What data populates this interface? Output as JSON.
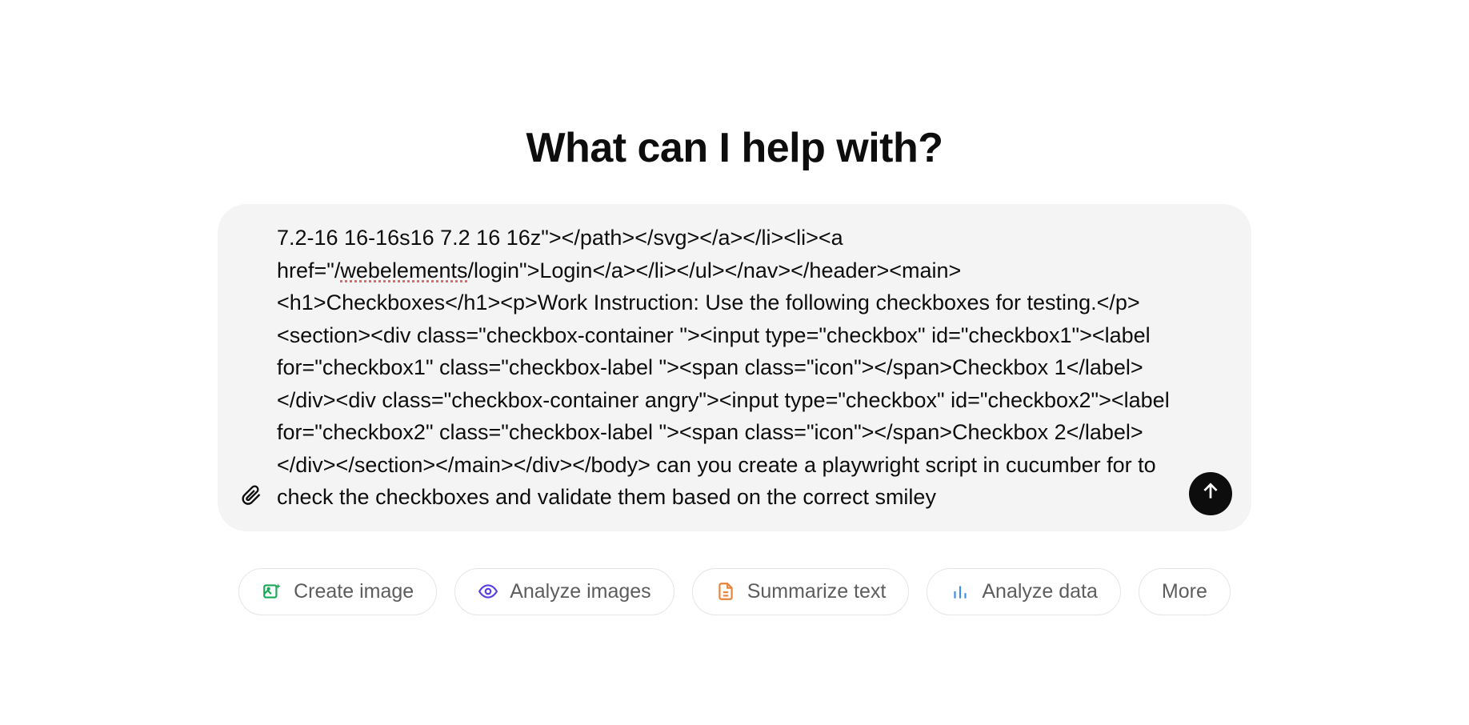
{
  "heading": "What can I help with?",
  "message": {
    "pre_underline": "7.2-16 16-16s16 7.2 16 16z\"></path></svg></a></li><li><a href=\"/",
    "underlined": "webelements",
    "post_underline": "/login\">Login</a></li></ul></nav></header><main><h1>Checkboxes</h1><p>Work Instruction: Use the following checkboxes for testing.</p><section><div class=\"checkbox-container \"><input type=\"checkbox\" id=\"checkbox1\"><label for=\"checkbox1\" class=\"checkbox-label \"><span class=\"icon\"></span>Checkbox 1</label></div><div class=\"checkbox-container angry\"><input type=\"checkbox\" id=\"checkbox2\"><label for=\"checkbox2\" class=\"checkbox-label \"><span class=\"icon\"></span>Checkbox 2</label></div></section></main></div></body> can you create a playwright script in cucumber for to check the checkboxes and validate them based on the correct smiley"
  },
  "suggestions": [
    {
      "label": "Create image",
      "icon": "image-sparkle",
      "color": "#18a957"
    },
    {
      "label": "Analyze images",
      "icon": "eye",
      "color": "#5a3fe0"
    },
    {
      "label": "Summarize text",
      "icon": "document",
      "color": "#e8833a"
    },
    {
      "label": "Analyze data",
      "icon": "bar-chart",
      "color": "#3a8de8"
    },
    {
      "label": "More",
      "icon": "",
      "color": "#5d5d5d"
    }
  ]
}
